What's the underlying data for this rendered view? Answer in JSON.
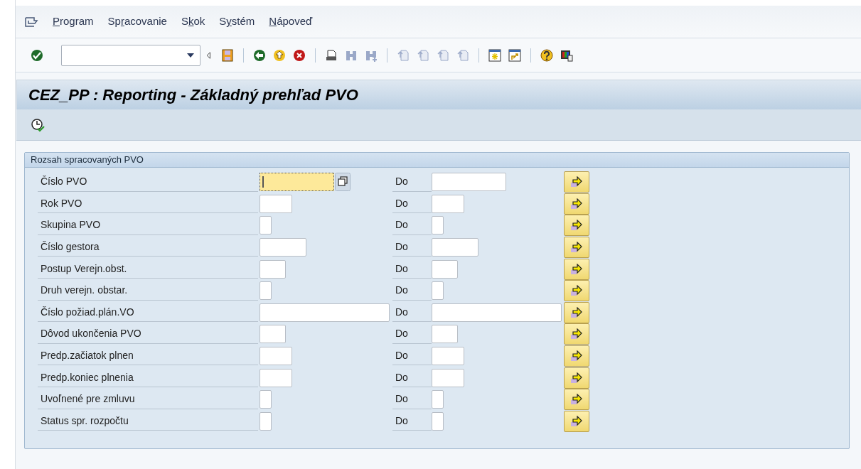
{
  "menu_bar": [
    {
      "parts": [
        {
          "text": "P",
          "underlined": true
        },
        {
          "text": "rogram",
          "underlined": false
        }
      ]
    },
    {
      "parts": [
        {
          "text": "Sp",
          "underlined": false
        },
        {
          "text": "r",
          "underlined": true
        },
        {
          "text": "acovanie",
          "underlined": false
        }
      ]
    },
    {
      "parts": [
        {
          "text": "S",
          "underlined": false
        },
        {
          "text": "k",
          "underlined": true
        },
        {
          "text": "ok",
          "underlined": false
        }
      ]
    },
    {
      "parts": [
        {
          "text": "S",
          "underlined": false
        },
        {
          "text": "y",
          "underlined": true
        },
        {
          "text": "stém",
          "underlined": false
        }
      ]
    },
    {
      "parts": [
        {
          "text": "N",
          "underlined": true
        },
        {
          "text": "ápoveď",
          "underlined": false
        }
      ]
    }
  ],
  "screen_title": "CEZ_PP : Reporting - Základný prehľad PVO",
  "group": {
    "title": "Rozsah spracovaných PVO",
    "rows": [
      {
        "label": "Číslo PVO",
        "to_label": "Do",
        "focused": true
      },
      {
        "label": "Rok PVO",
        "to_label": "Do",
        "focused": false
      },
      {
        "label": "Skupina PVO",
        "to_label": "Do",
        "focused": false
      },
      {
        "label": "Číslo gestora",
        "to_label": "Do",
        "focused": false
      },
      {
        "label": "Postup Verejn.obst.",
        "to_label": "Do",
        "focused": false
      },
      {
        "label": "Druh verejn. obstar.",
        "to_label": "Do",
        "focused": false
      },
      {
        "label": "Číslo požiad.plán.VO",
        "to_label": "Do",
        "focused": false
      },
      {
        "label": "Dôvod ukončenia PVO",
        "to_label": "Do",
        "focused": false
      },
      {
        "label": "Predp.začiatok plnen",
        "to_label": "Do",
        "focused": false
      },
      {
        "label": "Predp.koniec plnenia",
        "to_label": "Do",
        "focused": false
      },
      {
        "label": "Uvoľnené pre zmluvu",
        "to_label": "Do",
        "focused": false
      },
      {
        "label": "Status spr. rozpočtu",
        "to_label": "Do",
        "focused": false
      }
    ]
  }
}
